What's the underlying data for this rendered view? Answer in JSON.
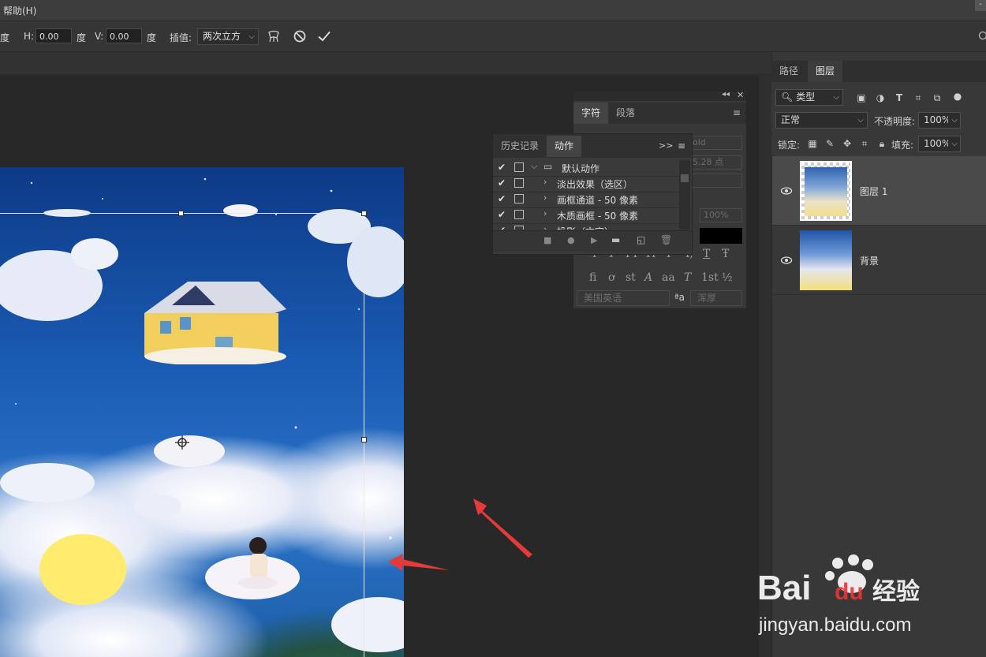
{
  "menu": {
    "help": "帮助(H)",
    "corner": "-"
  },
  "options": {
    "degree_label": "度",
    "h_label": "H:",
    "h_value": "0.00",
    "degree_label2": "度",
    "v_label": "V:",
    "v_value": "0.00",
    "degree_label3": "度",
    "interp_label": "插值:",
    "interp_value": "两次立方"
  },
  "right_panel": {
    "tabs": [
      "路径",
      "图层"
    ],
    "filter_kind": "类型",
    "blend_mode": "正常",
    "opacity_label": "不透明度:",
    "opacity_value": "100%",
    "lock_label": "锁定:",
    "fill_label": "填充:",
    "fill_value": "100%",
    "layers": [
      {
        "name": "图层 1"
      },
      {
        "name": "背景"
      }
    ]
  },
  "character_panel": {
    "tabs": [
      "字符",
      "段落"
    ],
    "font_style": "old",
    "size": "5.28 点",
    "scale_value": "100%",
    "language": "美国英语",
    "aa_label": "ªa",
    "aa_value": "浑厚",
    "glyphs_row1": [
      "T",
      "T",
      "TT",
      "Tr",
      "T'",
      "T,",
      "T",
      "Ŧ"
    ],
    "glyphs_row2": [
      "fi",
      "ơ",
      "st",
      "A",
      "aa",
      "T",
      "1st",
      "½"
    ]
  },
  "actions_panel": {
    "tabs": [
      "历史记录",
      "动作"
    ],
    "items": [
      {
        "label": "默认动作",
        "checked": true,
        "type": "set"
      },
      {
        "label": "淡出效果（选区）",
        "checked": true,
        "type": "action"
      },
      {
        "label": "画框通道 - 50 像素",
        "checked": true,
        "type": "action"
      },
      {
        "label": "木质画框 - 50 像素",
        "checked": true,
        "type": "action"
      },
      {
        "label": "投影（文字）",
        "checked": true,
        "type": "action"
      }
    ]
  },
  "watermark": {
    "brand": "Bai",
    "brand2": "du",
    "tagline": "经验",
    "url": "jingyan.baidu.com"
  },
  "colors": {
    "accent_arrow": "#e53a3a",
    "selection": "#e8e8e8",
    "panel_bg": "#383838"
  }
}
